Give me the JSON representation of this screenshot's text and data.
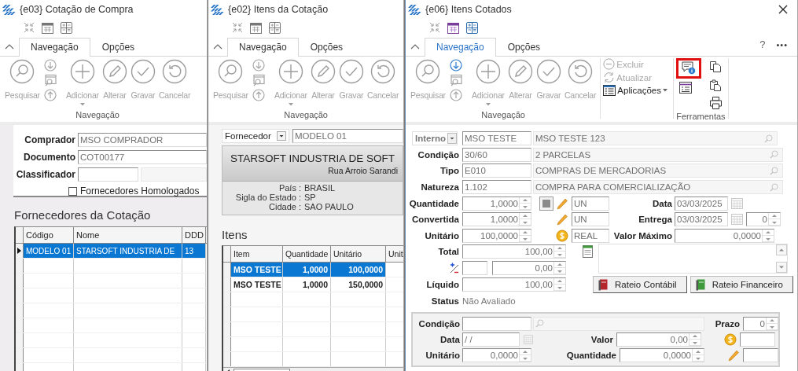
{
  "windows": [
    {
      "kind": "cotacao",
      "title": "{e03} Cotação de Compra",
      "focused": false,
      "closable": false,
      "tabs": [
        {
          "label": "Navegação",
          "selected": true
        },
        {
          "label": "Opções",
          "selected": false
        }
      ],
      "ribbon": {
        "group_label": "Navegação",
        "small_buttons": [
          {
            "kind": "next",
            "disabled": true
          },
          {
            "kind": "browse",
            "disabled": true
          },
          {
            "kind": "previous",
            "disabled": true
          }
        ],
        "buttons": [
          {
            "kind": "search",
            "label": "Pesquisar",
            "disabled": true,
            "dropdown": false
          },
          {
            "kind": "add",
            "label": "Adicionar",
            "disabled": true,
            "dropdown": true
          },
          {
            "kind": "edit",
            "label": "Alterar",
            "disabled": true,
            "dropdown": false
          },
          {
            "kind": "save",
            "label": "Gravar",
            "disabled": true,
            "dropdown": false
          },
          {
            "kind": "cancel",
            "label": "Cancelar",
            "disabled": true,
            "dropdown": false
          }
        ]
      },
      "form": {
        "fields": [
          {
            "label": "Comprador",
            "value": "MSO COMPRADOR",
            "description_field": false
          },
          {
            "label": "Documento",
            "value": "COT00177",
            "description_field": false
          },
          {
            "label": "Classificador",
            "description_field": true
          }
        ],
        "checkbox": {
          "label": "Fornecedores Homologados",
          "checked": false
        },
        "grid": {
          "title": "Fornecedores da Cotação",
          "columns": [
            "Código",
            "Nome",
            "DDD"
          ],
          "rows": [
            {
              "cells": [
                "MODELO 01",
                "STARSOFT INDUSTRIA DE",
                "13"
              ],
              "selected": true
            }
          ]
        }
      }
    },
    {
      "kind": "itens",
      "title": "{e02} Itens da Cotação",
      "focused": false,
      "closable": false,
      "tabs": [
        {
          "label": "Navegação",
          "selected": true
        },
        {
          "label": "Opções",
          "selected": false
        }
      ],
      "ribbon": {
        "group_label": "Navegação",
        "small_buttons": [
          {
            "kind": "next",
            "disabled": true
          },
          {
            "kind": "browse",
            "disabled": true
          },
          {
            "kind": "previous",
            "disabled": true
          }
        ],
        "buttons": [
          {
            "kind": "search",
            "label": "Pesquisar",
            "disabled": true,
            "dropdown": false
          },
          {
            "kind": "add",
            "label": "Adicionar",
            "disabled": true,
            "dropdown": true
          },
          {
            "kind": "edit",
            "label": "Alterar",
            "disabled": true,
            "dropdown": false
          },
          {
            "kind": "save",
            "label": "Gravar",
            "disabled": true,
            "dropdown": false
          },
          {
            "kind": "cancel",
            "label": "Cancelar",
            "disabled": true,
            "dropdown": false
          }
        ]
      },
      "form": {
        "filter": {
          "type": "Fornecedor",
          "value": "MODELO 01"
        },
        "supplier": {
          "name": "STARSOFT INDUSTRIA DE SOFT",
          "address": "Rua Arroio Sarandi",
          "details": [
            {
              "label": "País :",
              "value": "BRASIL"
            },
            {
              "label": "Sigla do Estado :",
              "value": "SP"
            },
            {
              "label": "Cidade :",
              "value": "SAO PAULO"
            }
          ]
        },
        "grid": {
          "title": "Itens",
          "columns": [
            "Item",
            "Quantidade",
            "Unitário",
            "Unit"
          ],
          "rows": [
            {
              "cells": [
                "MSO TESTE",
                "1,0000",
                "100,0000"
              ],
              "selected": true
            },
            {
              "cells": [
                "MSO TESTE",
                "1,0000",
                "150,0000"
              ],
              "selected": false
            }
          ]
        }
      }
    },
    {
      "kind": "cotados",
      "title": "{e06} Itens Cotados",
      "focused": true,
      "closable": true,
      "help": "?",
      "more": "•••",
      "tabs": [
        {
          "label": "Navegação",
          "selected": true
        },
        {
          "label": "Opções",
          "selected": false
        }
      ],
      "ribbon": {
        "group_label": "Navegação",
        "small_buttons": [
          {
            "kind": "next",
            "disabled": false
          },
          {
            "kind": "browse",
            "disabled": true
          },
          {
            "kind": "previous",
            "disabled": true
          }
        ],
        "buttons": [
          {
            "kind": "search",
            "label": "Pesquisar",
            "disabled": true,
            "dropdown": false
          },
          {
            "kind": "add",
            "label": "Adicionar",
            "disabled": true,
            "dropdown": true
          },
          {
            "kind": "edit",
            "label": "Alterar",
            "disabled": true,
            "dropdown": false
          },
          {
            "kind": "save",
            "label": "Gravar",
            "disabled": true,
            "dropdown": false
          },
          {
            "kind": "cancel",
            "label": "Cancelar",
            "disabled": true,
            "dropdown": false
          }
        ],
        "actions": [
          {
            "kind": "delete",
            "label": "Excluir",
            "disabled": true
          },
          {
            "kind": "refresh",
            "label": "Atualizar",
            "disabled": true
          },
          {
            "kind": "apps",
            "label": "Aplicações",
            "disabled": false
          }
        ],
        "tools": {
          "label": "Ferramentas",
          "items": [
            {
              "kind": "info",
              "highlighted": true
            },
            {
              "kind": "form",
              "highlighted": false
            },
            {
              "kind": "copy",
              "highlighted": false
            },
            {
              "kind": "paste",
              "highlighted": false
            },
            {
              "kind": "print",
              "highlighted": false
            }
          ]
        }
      },
      "form": {
        "origin": {
          "type": "Interno",
          "code": "MSO TESTE",
          "description": "MSO TESTE 123"
        },
        "lookups": [
          {
            "label": "Condição",
            "code": "30/60",
            "description": "2 PARCELAS"
          },
          {
            "label": "Tipo",
            "code": "E010",
            "description": "COMPRAS DE MERCADORIAS"
          },
          {
            "label": "Natureza",
            "code": "1.102",
            "description": "COMPRA PARA COMERCIALIZAÇÃO"
          }
        ],
        "quantity": {
          "label": "Quantidade",
          "value": "1,0000",
          "unit": "UN"
        },
        "converted": {
          "label": "Convertida",
          "value": "1,0000",
          "unit": "UN"
        },
        "unit_price": {
          "label": "Unitário",
          "value": "100,0000",
          "currency": "REAL"
        },
        "date": {
          "label": "Data",
          "value": "03/03/2025"
        },
        "delivery": {
          "label": "Entrega",
          "value": "03/03/2025",
          "days": "0"
        },
        "max_value": {
          "label": "Valor Máximo",
          "value": "0,0000"
        },
        "total": {
          "label": "Total",
          "value": "100,00"
        },
        "adjustment": {
          "value": "0,00"
        },
        "net": {
          "label": "Líquido",
          "value": "100,00"
        },
        "buttons": [
          {
            "kind": "accounting",
            "label": "Rateio Contábil"
          },
          {
            "kind": "financial",
            "label": "Rateio Financeiro"
          }
        ],
        "status": {
          "label": "Status",
          "value": "Não Avaliado"
        },
        "payment": {
          "condition": {
            "label": "Condição"
          },
          "term": {
            "label": "Prazo",
            "value": "0"
          },
          "date": {
            "label": "Data",
            "value": "/ /"
          },
          "amount": {
            "label": "Valor",
            "value": "0,00"
          },
          "unit_price": {
            "label": "Unitário",
            "value": "0,0000"
          },
          "quantity": {
            "label": "Quantidade",
            "value": "0,0000"
          }
        }
      }
    }
  ]
}
